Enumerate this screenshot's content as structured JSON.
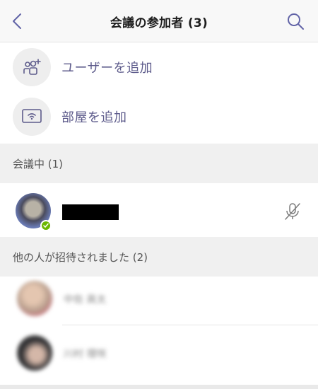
{
  "header": {
    "title": "会議の参加者 (3)",
    "back_icon": "chevron-left-icon",
    "search_icon": "search-icon"
  },
  "actions": {
    "add_user": {
      "label": "ユーザーを追加",
      "icon": "add-people-icon"
    },
    "add_room": {
      "label": "部屋を追加",
      "icon": "room-device-icon"
    }
  },
  "sections": {
    "in_meeting": {
      "label": "会議中 (1)"
    },
    "invited": {
      "label": "他の人が招待されました (2)"
    }
  },
  "participants": [
    {
      "name_redacted": true,
      "status": "available",
      "mic_icon": "mic-off-icon"
    }
  ],
  "invited_people": [
    {
      "name": "中佐 眞太"
    },
    {
      "name": "川村 理咲"
    }
  ],
  "colors": {
    "accent": "#5d5b8b",
    "status_available": "#6bb700",
    "section_bg": "#f0f0f0"
  }
}
